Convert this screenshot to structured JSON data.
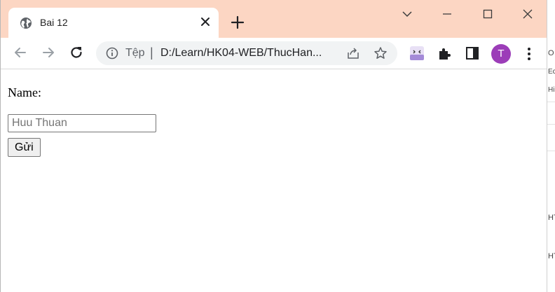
{
  "browser": {
    "tab": {
      "title": "Bai 12",
      "favicon": "globe-icon",
      "close": "close-icon"
    },
    "new_tab": "plus-icon",
    "window_controls": [
      "chevron-down-icon",
      "minimize-icon",
      "maximize-icon",
      "close-icon"
    ],
    "titlebar_color": "#fcd6c3",
    "address_bar": {
      "scheme_label": "Tệp",
      "separator": "|",
      "url": "D:/Learn/HK04-WEB/ThucHan..."
    },
    "profile_initial": "T",
    "profile_color": "#9c3db8"
  },
  "page": {
    "label": "Name:",
    "input_placeholder": "Huu Thuan",
    "submit_label": "Gửi"
  },
  "background_window": {
    "fragments": [
      "O",
      "Ec",
      "Hi",
      "HT",
      "HT"
    ]
  }
}
